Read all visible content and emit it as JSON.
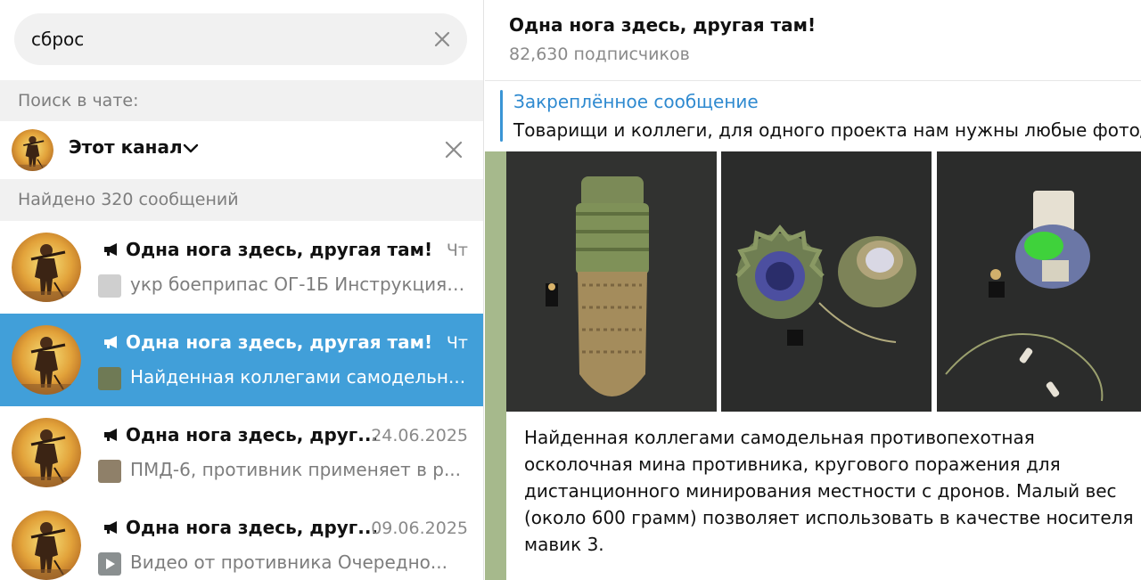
{
  "search": {
    "value": "сброс"
  },
  "sections": {
    "search_in": "Поиск в чате:",
    "found": "Найдено 320 сообщений"
  },
  "filter": {
    "label": "Этот канал"
  },
  "results": [
    {
      "title": "Одна нога здесь, другая там!",
      "date": "Чт",
      "snippet": "укр боеприпас ОГ-1Б Инструкция ..."
    },
    {
      "title": "Одна нога здесь, другая там!",
      "date": "Чт",
      "snippet": "Найденная коллегами самодельн..."
    },
    {
      "title": "Одна нога здесь, друг...",
      "date": "24.06.2025",
      "snippet": "ПМД-6, противник применяет в р..."
    },
    {
      "title": "Одна нога здесь, друг...",
      "date": "09.06.2025",
      "snippet": "Видео от противника   Очередно..."
    }
  ],
  "chat": {
    "title": "Одна нога здесь, другая там!",
    "subscribers": "82,630 подписчиков",
    "pinned_label": "Закреплённое сообщение",
    "pinned_text": "Товарищи и коллеги, для одного проекта нам нужны любые фото/",
    "message_text": "Найденная коллегами самодельная противопехотная осколочная мина противника, кругового поражения для дистанционного минирования местности с дронов. Малый вес (около 600 грамм) позволяет использовать в качестве носителя мавик 3."
  },
  "icons": {
    "clear": "close-icon",
    "chevron": "chevron-down-icon",
    "channel": "megaphone-icon"
  },
  "colors": {
    "accent": "#419fd9",
    "link": "#2f8ad0",
    "chat_bg": "#a6b98c"
  }
}
